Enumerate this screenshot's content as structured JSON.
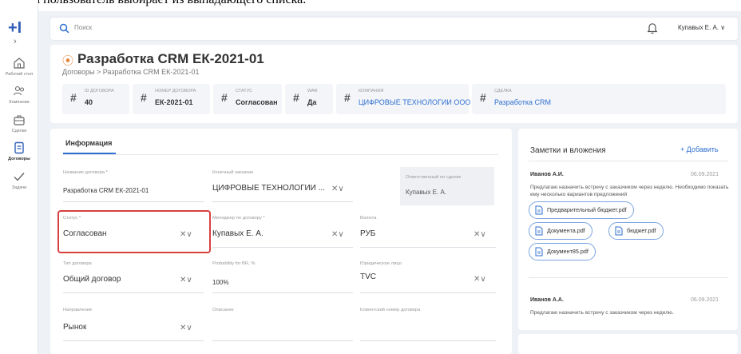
{
  "caption": "статуса пользователь выбирает из выпадающего списка.",
  "sidebar": {
    "items": [
      {
        "label": "Рабочий стол",
        "icon": "home-icon"
      },
      {
        "label": "Компании",
        "icon": "people-icon"
      },
      {
        "label": "Сделки",
        "icon": "briefcase-icon"
      },
      {
        "label": "Договоры",
        "icon": "document-icon"
      },
      {
        "label": "Задачи",
        "icon": "check-icon"
      }
    ]
  },
  "topbar": {
    "search_placeholder": "Поиск",
    "user_name": "Купавых Е. А."
  },
  "header": {
    "title": "Разработка CRM ЕК-2021-01",
    "breadcrumb": "Договоры  >  Разработка CRM ЕК-2021-01",
    "fields": [
      {
        "key": "ID ДОГОВОРА",
        "value": "40"
      },
      {
        "key": "НОМЕР ДОГОВОРА",
        "value": "ЕК-2021-01"
      },
      {
        "key": "СТАТУС",
        "value": "Согласован"
      },
      {
        "key": "WAR",
        "value": "Да"
      },
      {
        "key": "КОМПАНИЯ",
        "value": "ЦИФРОВЫЕ ТЕХНОЛОГИИ ООО"
      },
      {
        "key": "СДЕЛКА",
        "value": "Разработка CRM"
      }
    ]
  },
  "form": {
    "tab": "Информация",
    "fields": {
      "name": {
        "label": "Название договора *",
        "value": "Разработка CRM ЕК-2021-01"
      },
      "customer": {
        "label": "Конечный заказчик",
        "value": "ЦИФРОВЫЕ ТЕХНОЛОГИИ ..."
      },
      "responsible": {
        "label": "Ответственный по сделке",
        "value": "Купавых Е. А."
      },
      "status": {
        "label": "Статус *",
        "value": "Согласован"
      },
      "manager": {
        "label": "Менеджер по договору *",
        "value": "Купавых Е. А."
      },
      "currency": {
        "label": "Валюта",
        "value": "РУБ"
      },
      "type": {
        "label": "Тип договора",
        "value": "Общий договор"
      },
      "probability": {
        "label": "Probability for BR, %",
        "value": "100%"
      },
      "legal": {
        "label": "Юридическое лицо",
        "value": "TVC"
      },
      "direction": {
        "label": "Направление",
        "value": "Рынок"
      },
      "description": {
        "label": "Описание",
        "value": ""
      },
      "client_number": {
        "label": "Клиентский номер договора",
        "value": ""
      }
    }
  },
  "notes": {
    "title": "Заметки и вложения",
    "add_label": "+ Добавить",
    "entries": [
      {
        "author": "Иванов А.И.",
        "date": "06.09.2021",
        "text": "Предлагаю назначить встречу с заказчиком через неделю. Необходимо показать ему несколько вариантов предложений",
        "files": [
          "Предварительный бюджет.pdf",
          "Документа.pdf",
          "бюджет.pdf",
          "Документ85.pdf"
        ]
      },
      {
        "author": "Иванов А.А.",
        "date": "06.09.2021",
        "text": "Предлагаю назначить встречу с заказчиком через неделю."
      }
    ]
  }
}
